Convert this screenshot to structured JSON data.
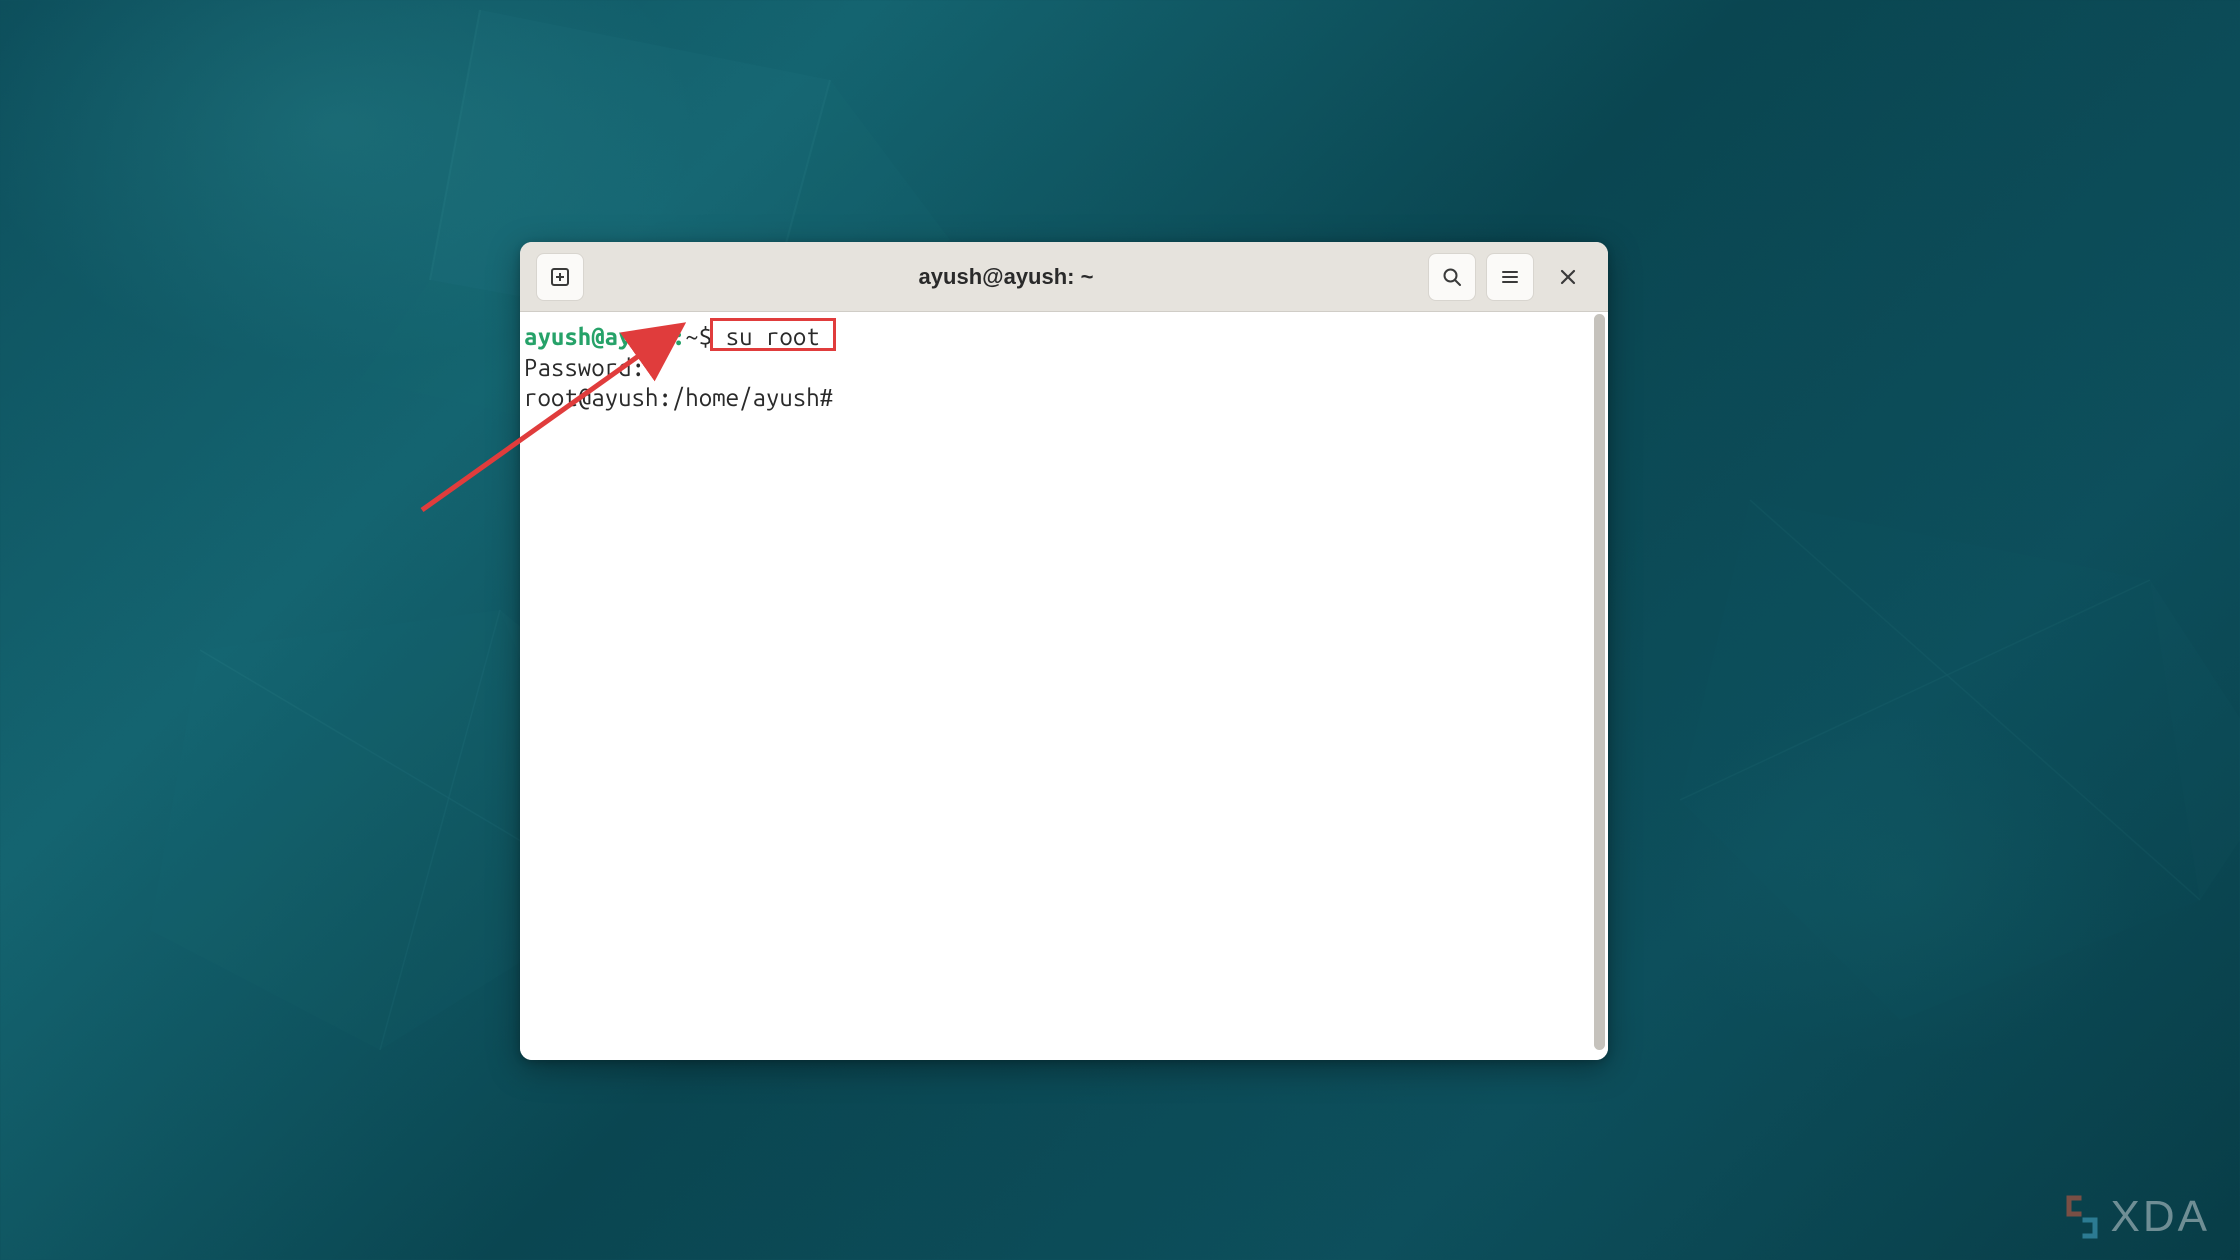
{
  "window": {
    "title": "ayush@ayush: ~"
  },
  "terminal": {
    "line1": {
      "user_host": "ayush@ayush",
      "sep": ":",
      "path": "~",
      "symbol": "$",
      "command": "su root"
    },
    "line2": "Password:",
    "line3": "root@ayush:/home/ayush#"
  },
  "watermark": {
    "text": "XDA"
  },
  "icons": {
    "new_tab": "new-tab",
    "search": "search",
    "menu": "hamburger-menu",
    "close": "close"
  },
  "annotation": {
    "highlighted_command": "su root"
  }
}
